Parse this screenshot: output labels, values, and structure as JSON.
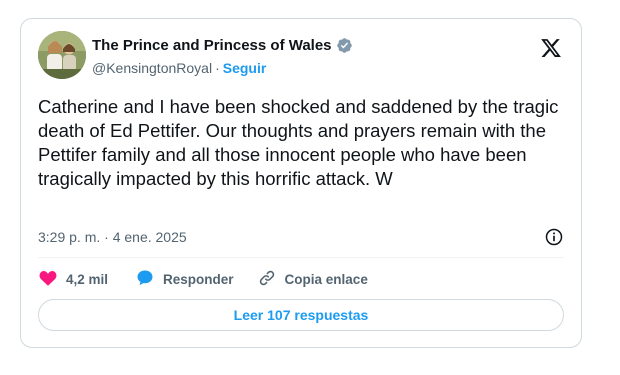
{
  "author": {
    "display_name": "The Prince and Princess of Wales",
    "handle": "@KensingtonRoyal",
    "separator": "·",
    "follow_label": "Seguir"
  },
  "tweet": {
    "text": "Catherine and I have been shocked and saddened by the tragic death of Ed Pettifer. Our thoughts and prayers remain with the Pettifer family and all those innocent people who have been tragically impacted by this horrific attack. W",
    "timestamp": "3:29 p. m. · 4 ene. 2025"
  },
  "actions": {
    "like_count": "4,2 mil",
    "reply_label": "Responder",
    "copy_link_label": "Copia enlace"
  },
  "footer": {
    "read_replies_label": "Leer 107 respuestas"
  },
  "icons": {
    "brand": "x-logo-icon",
    "verified": "verified-badge-icon",
    "info": "info-icon",
    "like": "heart-icon",
    "reply": "speech-bubble-icon",
    "copy_link": "link-icon"
  },
  "colors": {
    "accent": "#1d9bf0",
    "like": "#f91880",
    "verified_badge": "#829aab",
    "text_primary": "#0f1419",
    "text_secondary": "#536471",
    "border": "#cfd9de"
  }
}
